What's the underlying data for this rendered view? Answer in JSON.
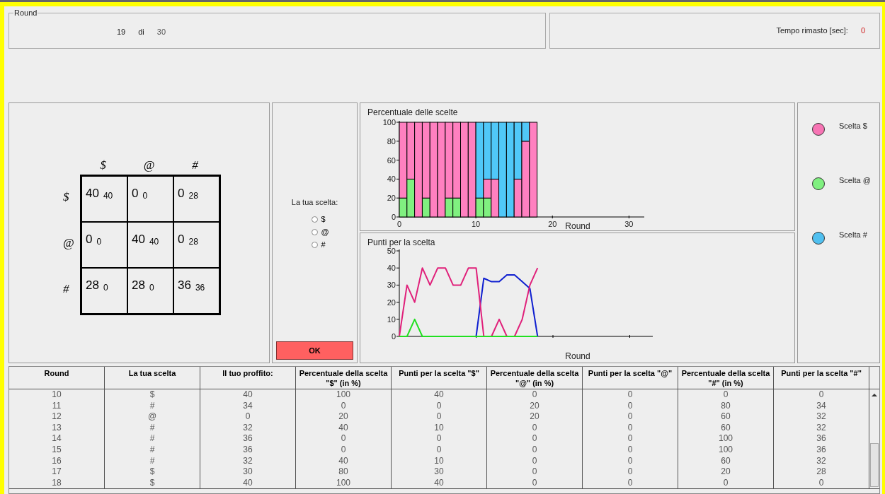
{
  "round_panel": {
    "legend": "Round",
    "current": "19",
    "separator": "di",
    "total": "30"
  },
  "timer": {
    "label": "Tempo rimasto [sec]:",
    "value": "0"
  },
  "matrix": {
    "column_headers": [
      "$",
      "@",
      "#"
    ],
    "rows": [
      {
        "header": "$",
        "cells": [
          {
            "main": "40",
            "other": "40"
          },
          {
            "main": "0",
            "other": "0"
          },
          {
            "main": "0",
            "other": "28"
          }
        ]
      },
      {
        "header": "@",
        "cells": [
          {
            "main": "0",
            "other": "0"
          },
          {
            "main": "40",
            "other": "40"
          },
          {
            "main": "0",
            "other": "28"
          }
        ]
      },
      {
        "header": "#",
        "cells": [
          {
            "main": "28",
            "other": "0"
          },
          {
            "main": "28",
            "other": "0"
          },
          {
            "main": "36",
            "other": "36"
          }
        ]
      }
    ]
  },
  "choice": {
    "label": "La tua scelta:",
    "options": [
      {
        "label": "$",
        "selected": false
      },
      {
        "label": "@",
        "selected": false
      },
      {
        "label": "#",
        "selected": false
      }
    ],
    "button": "OK"
  },
  "charts": [
    {
      "chart_data": {
        "type": "bar",
        "title": "Percentuale delle scelte",
        "xlabel": "Round",
        "stacked": true,
        "x": [
          0.5,
          1.5,
          2.5,
          3.5,
          4.5,
          5.5,
          6.5,
          7.5,
          8.5,
          9.5,
          10.5,
          11.5,
          12.5,
          13.5,
          14.5,
          15.5,
          16.5,
          17.5
        ],
        "xlim": [
          0,
          32
        ],
        "ylim": [
          0,
          100
        ],
        "xticks": [
          0,
          10,
          20,
          30
        ],
        "yticks": [
          0,
          20,
          40,
          60,
          80,
          100
        ],
        "series": [
          {
            "color": "#80f080",
            "values": [
              20,
              40,
              0,
              20,
              0,
              0,
              20,
              20,
              0,
              0,
              20,
              20,
              0,
              0,
              0,
              0,
              0,
              0
            ]
          },
          {
            "color": "#ff80c0",
            "values": [
              80,
              60,
              100,
              80,
              100,
              100,
              80,
              80,
              100,
              100,
              0,
              20,
              40,
              0,
              0,
              40,
              80,
              100
            ]
          },
          {
            "color": "#50c8f8",
            "values": [
              0,
              0,
              0,
              0,
              0,
              0,
              0,
              0,
              0,
              0,
              80,
              60,
              60,
              100,
              100,
              60,
              20,
              0
            ]
          }
        ]
      }
    },
    {
      "chart_data": {
        "type": "line",
        "title": "Punti per la scelta",
        "xlabel": "Round",
        "categories": [
          null,
          null,
          null,
          null,
          null,
          null,
          null,
          null,
          null,
          null,
          null,
          null,
          null,
          null,
          null,
          null,
          null,
          null,
          null
        ],
        "ylim": [
          0,
          50
        ],
        "yticks": [
          0,
          10,
          20,
          30,
          40,
          50
        ],
        "series": [
          {
            "color": "#1020d0",
            "values": [
              null,
              null,
              null,
              null,
              null,
              null,
              null,
              null,
              null,
              null,
              0,
              34,
              32,
              32,
              36,
              36,
              32,
              28,
              0
            ]
          },
          {
            "color": "#e0207a",
            "values": [
              0,
              30,
              20,
              40,
              30,
              40,
              40,
              30,
              30,
              40,
              40,
              0,
              0,
              10,
              0,
              0,
              10,
              30,
              40
            ]
          },
          {
            "color": "#20e020",
            "values": [
              0,
              0,
              10,
              0,
              0,
              0,
              0,
              0,
              0,
              0,
              0,
              0,
              0,
              0,
              0,
              0,
              0,
              0,
              0
            ]
          }
        ]
      }
    }
  ],
  "legend": {
    "items": [
      {
        "label": "Scelta $",
        "color": "#f774b4"
      },
      {
        "label": "Scelta @",
        "color": "#80f080"
      },
      {
        "label": "Scelta #",
        "color": "#50c0f0"
      }
    ]
  },
  "table": {
    "columns": [
      "Round",
      "La tua scelta",
      "Il tuo proffito:",
      "Percentuale della scelta \"$\" (in %)",
      "Punti per la scelta \"$\"",
      "Percentuale della scelta \"@\" (in %)",
      "Punti per la scelta \"@\"",
      "Percentuale della scelta \"#\" (in %)",
      "Punti per la scelta \"#\""
    ],
    "rows": [
      [
        "10",
        "$",
        "40",
        "100",
        "40",
        "0",
        "0",
        "0",
        "0"
      ],
      [
        "11",
        "#",
        "34",
        "0",
        "0",
        "20",
        "0",
        "80",
        "34"
      ],
      [
        "12",
        "@",
        "0",
        "20",
        "0",
        "20",
        "0",
        "60",
        "32"
      ],
      [
        "13",
        "#",
        "32",
        "40",
        "10",
        "0",
        "0",
        "60",
        "32"
      ],
      [
        "14",
        "#",
        "36",
        "0",
        "0",
        "0",
        "0",
        "100",
        "36"
      ],
      [
        "15",
        "#",
        "36",
        "0",
        "0",
        "0",
        "0",
        "100",
        "36"
      ],
      [
        "16",
        "#",
        "32",
        "40",
        "10",
        "0",
        "0",
        "60",
        "32"
      ],
      [
        "17",
        "$",
        "30",
        "80",
        "30",
        "0",
        "0",
        "20",
        "28"
      ],
      [
        "18",
        "$",
        "40",
        "100",
        "40",
        "0",
        "0",
        "0",
        "0"
      ]
    ]
  }
}
